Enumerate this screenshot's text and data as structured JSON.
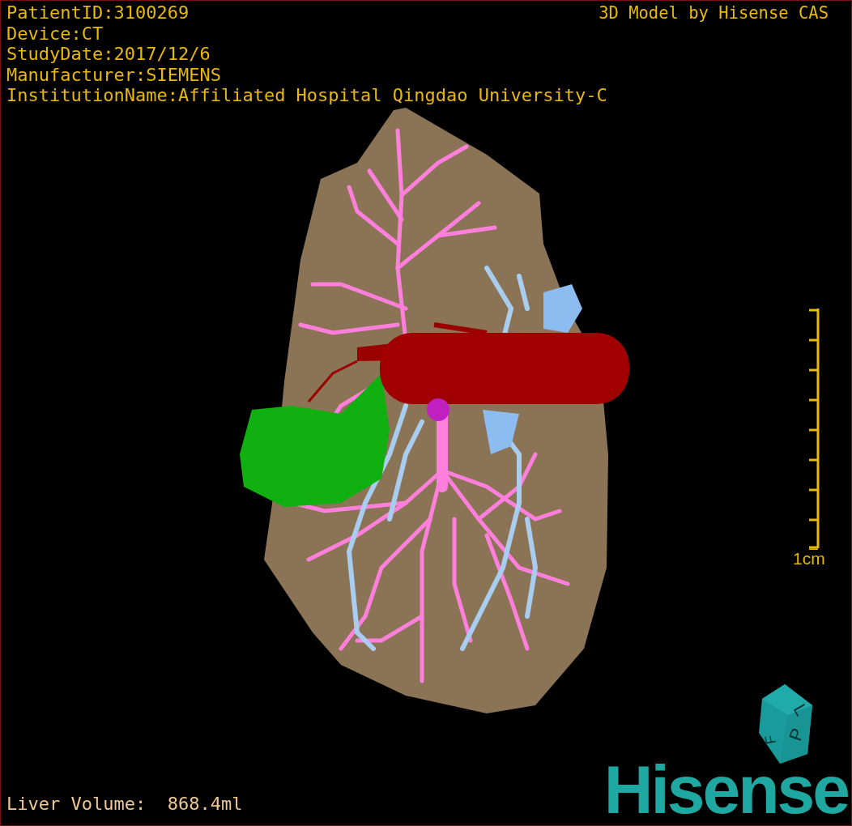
{
  "study_info": [
    "PatientID:3100269",
    "Device:CT",
    "StudyDate:2017/12/6",
    "Manufacturer:SIEMENS",
    "InstitutionName:Affiliated Hospital Qingdao University-C"
  ],
  "viewer_title": "3D Model by Hisense CAS",
  "scale_bar": {
    "label": "1cm"
  },
  "orientation_cube": {
    "labels": [
      "L",
      "P",
      "F"
    ]
  },
  "logo": "Hisense",
  "liver_volume": "Liver Volume:  868.4ml"
}
